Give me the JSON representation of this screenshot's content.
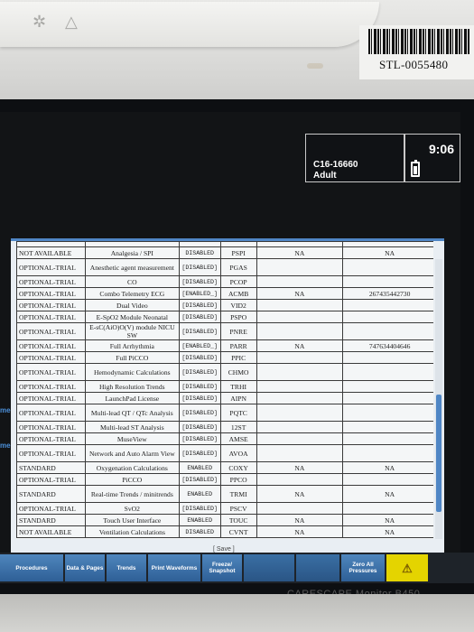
{
  "device": {
    "asset_tag": "STL-0055480",
    "brand": "CARESCAPE Monitor B450",
    "icons": [
      "alarm-silence-icon",
      "alarm-triangle-icon"
    ]
  },
  "header": {
    "patient_id": "C16-16660",
    "patient_type": "Adult",
    "time": "9:06",
    "battery_icon": "battery-icon"
  },
  "side_fragments": [
    "ment",
    "me"
  ],
  "table": {
    "rows": [
      {
        "status": "NOT AVAILABLE",
        "name": "Analgesia / SPI",
        "state": "DISABLED",
        "code": "PSPI",
        "val1": "NA",
        "val2": "NA",
        "tall": false
      },
      {
        "status": "OPTIONAL-TRIAL",
        "name": "Anesthetic agent measurement",
        "state": "[DISABLED]",
        "code": "PGAS",
        "val1": "",
        "val2": "",
        "tall": true
      },
      {
        "status": "OPTIONAL-TRIAL",
        "name": "CO",
        "state": "[DISABLED]",
        "code": "PCOP",
        "val1": "",
        "val2": "",
        "tall": false
      },
      {
        "status": "OPTIONAL-TRIAL",
        "name": "Combo Telemetry ECG",
        "state": "[ENABLED_]",
        "code": "ACMB",
        "val1": "NA",
        "val2": "267435442730",
        "tall": false
      },
      {
        "status": "OPTIONAL-TRIAL",
        "name": "Dual Video",
        "state": "[DISABLED]",
        "code": "VID2",
        "val1": "",
        "val2": "",
        "tall": false
      },
      {
        "status": "OPTIONAL-TRIAL",
        "name": "E-SpO2 Module Neonatal",
        "state": "[DISABLED]",
        "code": "PSPO",
        "val1": "",
        "val2": "",
        "tall": false
      },
      {
        "status": "OPTIONAL-TRIAL",
        "name": "E-sC(AiO)O(V) module NICU SW",
        "state": "[DISABLED]",
        "code": "PNRE",
        "val1": "",
        "val2": "",
        "tall": true
      },
      {
        "status": "OPTIONAL-TRIAL",
        "name": "Full Arrhythmia",
        "state": "[ENABLED_]",
        "code": "PARR",
        "val1": "NA",
        "val2": "747634404646",
        "tall": false
      },
      {
        "status": "OPTIONAL-TRIAL",
        "name": "Full PiCCO",
        "state": "[DISABLED]",
        "code": "PPIC",
        "val1": "",
        "val2": "",
        "tall": false
      },
      {
        "status": "OPTIONAL-TRIAL",
        "name": "Hemodynamic Calculations",
        "state": "[DISABLED]",
        "code": "CHMO",
        "val1": "",
        "val2": "",
        "tall": true
      },
      {
        "status": "OPTIONAL-TRIAL",
        "name": "High Resolution Trends",
        "state": "[DISABLED]",
        "code": "TRHI",
        "val1": "",
        "val2": "",
        "tall": false
      },
      {
        "status": "OPTIONAL-TRIAL",
        "name": "LaunchPad License",
        "state": "[DISABLED]",
        "code": "AIPN",
        "val1": "",
        "val2": "",
        "tall": false
      },
      {
        "status": "OPTIONAL-TRIAL",
        "name": "Multi-lead QT / QTc Analysis",
        "state": "[DISABLED]",
        "code": "PQTC",
        "val1": "",
        "val2": "",
        "tall": true
      },
      {
        "status": "OPTIONAL-TRIAL",
        "name": "Multi-lead ST Analysis",
        "state": "[DISABLED]",
        "code": "12ST",
        "val1": "",
        "val2": "",
        "tall": false
      },
      {
        "status": "OPTIONAL-TRIAL",
        "name": "MuseView",
        "state": "[DISABLED]",
        "code": "AMSE",
        "val1": "",
        "val2": "",
        "tall": false
      },
      {
        "status": "OPTIONAL-TRIAL",
        "name": "Network and Auto Alarm View",
        "state": "[DISABLED]",
        "code": "AVOA",
        "val1": "",
        "val2": "",
        "tall": true
      },
      {
        "status": "STANDARD",
        "name": "Oxygenation Calculations",
        "state": "ENABLED",
        "code": "COXY",
        "val1": "NA",
        "val2": "NA",
        "tall": false
      },
      {
        "status": "OPTIONAL-TRIAL",
        "name": "PiCCO",
        "state": "[DISABLED]",
        "code": "PPCO",
        "val1": "",
        "val2": "",
        "tall": false
      },
      {
        "status": "STANDARD",
        "name": "Real-time Trends / minitrends",
        "state": "ENABLED",
        "code": "TRMI",
        "val1": "NA",
        "val2": "NA",
        "tall": true
      },
      {
        "status": "OPTIONAL-TRIAL",
        "name": "SvO2",
        "state": "[DISABLED]",
        "code": "PSCV",
        "val1": "",
        "val2": "",
        "tall": false
      },
      {
        "status": "STANDARD",
        "name": "Touch User Interface",
        "state": "ENABLED",
        "code": "TOUC",
        "val1": "NA",
        "val2": "NA",
        "tall": false
      },
      {
        "status": "NOT AVAILABLE",
        "name": "Ventilation Calculations",
        "state": "DISABLED",
        "code": "CVNT",
        "val1": "NA",
        "val2": "NA",
        "tall": false
      }
    ]
  },
  "save_label": "[ Save ]",
  "menu": {
    "items": [
      "Procedures",
      "Data & Pages",
      "Trends",
      "Print Waveforms",
      "Freeze/ Snapshot",
      "",
      "",
      "Zero All Pressures",
      ""
    ]
  }
}
